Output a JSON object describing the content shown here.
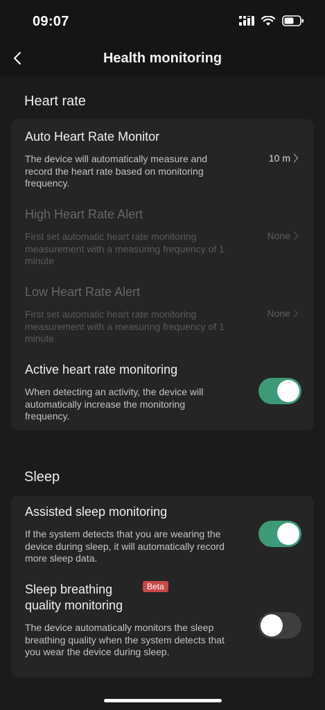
{
  "status_bar": {
    "time": "09:07",
    "icons": [
      "signal-icon",
      "wifi-icon",
      "battery-icon"
    ]
  },
  "header": {
    "title": "Health monitoring",
    "back_icon": "back-chevron-icon"
  },
  "heart_rate": {
    "section_title": "Heart rate",
    "items": [
      {
        "title": "Auto Heart Rate Monitor",
        "description": "The device will automatically measure and record the heart rate based on monitoring frequency.",
        "value": "10 m",
        "enabled": true
      },
      {
        "title": "High Heart Rate Alert",
        "description": "First set automatic heart rate monitoring measurement with a measuring frequency of 1 minute",
        "value": "None",
        "enabled": false
      },
      {
        "title": "Low Heart Rate Alert",
        "description": "First set automatic heart rate monitoring measurement with a measuring frequency of 1 minute",
        "value": "None",
        "enabled": false
      },
      {
        "title": "Active heart rate monitoring",
        "description": "When detecting an activity, the device will automatically increase the monitoring frequency.",
        "toggle": true
      }
    ]
  },
  "sleep": {
    "section_title": "Sleep",
    "items": [
      {
        "title": "Assisted sleep monitoring",
        "description": "If the system detects that you are wearing the device during sleep, it will automatically record more sleep data.",
        "toggle": true
      },
      {
        "title_line1": "Sleep breathing",
        "title_line2": "quality monitoring",
        "badge": "Beta",
        "description": "The device automatically monitors the sleep breathing quality when the system detects that you wear the device during sleep.",
        "toggle": false
      }
    ]
  },
  "colors": {
    "toggle_on": "#3c9a76",
    "toggle_off": "#3e3e3e",
    "badge": "#c8484a",
    "card_bg": "#252525",
    "page_bg": "#1b1b1b"
  }
}
